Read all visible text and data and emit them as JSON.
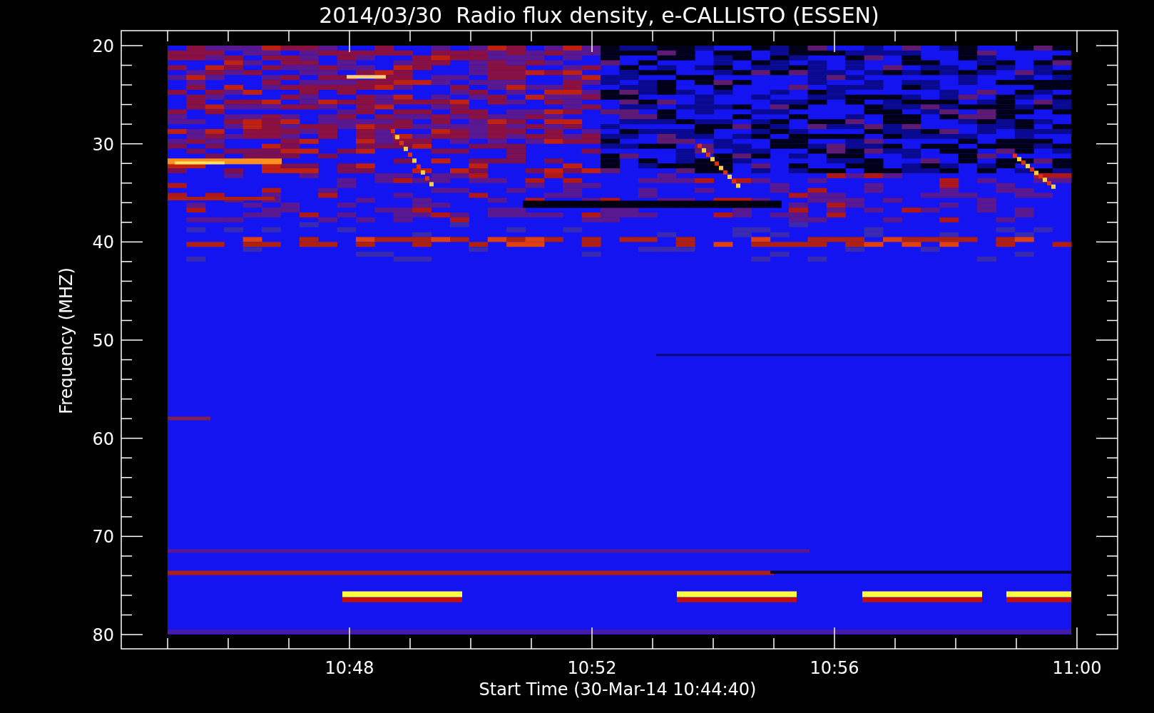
{
  "plot": {
    "title": "2014/03/30  Radio flux density, e-CALLISTO (ESSEN)",
    "ylabel": "Frequency (MHZ)",
    "xlabel": "Start Time (30-Mar-14 10:44:40)",
    "yticks": [
      "20",
      "30",
      "40",
      "50",
      "60",
      "70",
      "80"
    ],
    "xticks": [
      "10:48",
      "10:52",
      "10:56",
      "11:00"
    ]
  }
}
